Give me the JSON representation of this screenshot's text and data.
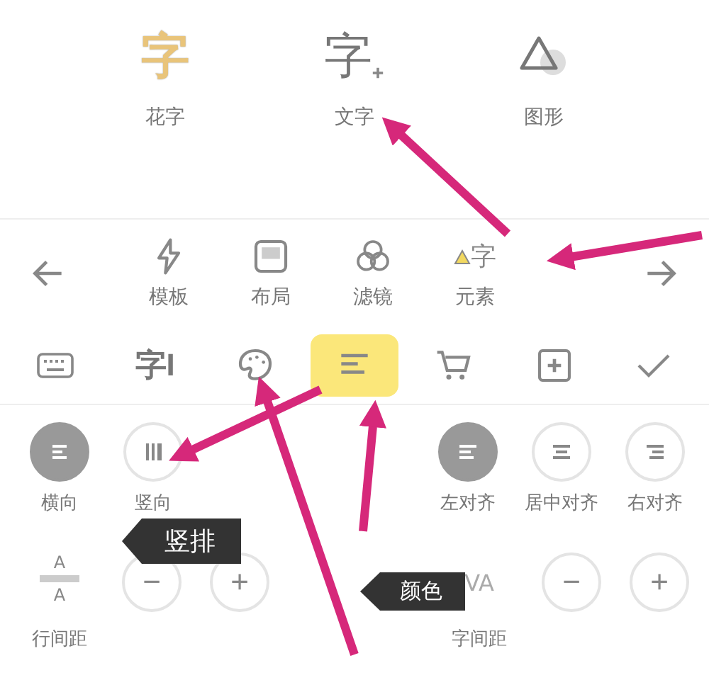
{
  "top_panel": {
    "items": [
      {
        "kind": "fancy",
        "glyph": "字",
        "label": "花字"
      },
      {
        "kind": "text",
        "glyph": "字",
        "label": "文字"
      },
      {
        "kind": "shape",
        "label": "图形"
      }
    ]
  },
  "nav": {
    "items": [
      {
        "kind": "template",
        "label": "模板"
      },
      {
        "kind": "layout",
        "label": "布局"
      },
      {
        "kind": "filter",
        "label": "滤镜"
      },
      {
        "kind": "element",
        "glyph": "字",
        "label": "元素"
      }
    ]
  },
  "toolbar": {
    "items": [
      {
        "kind": "keyboard",
        "selected": false
      },
      {
        "kind": "font",
        "glyph": "字I",
        "selected": false
      },
      {
        "kind": "palette",
        "selected": false
      },
      {
        "kind": "align",
        "selected": true
      },
      {
        "kind": "cart",
        "selected": false
      },
      {
        "kind": "add",
        "selected": false
      },
      {
        "kind": "check",
        "selected": false
      }
    ]
  },
  "orientation": [
    {
      "kind": "horizontal",
      "label": "横向",
      "selected": true
    },
    {
      "kind": "vertical",
      "label": "竖向",
      "selected": false
    }
  ],
  "alignment": [
    {
      "kind": "left",
      "label": "左对齐",
      "selected": true
    },
    {
      "kind": "center",
      "label": "居中对齐",
      "selected": false
    },
    {
      "kind": "right",
      "label": "右对齐",
      "selected": false
    }
  ],
  "spacing": [
    {
      "kind": "line",
      "glyph_top": "A",
      "glyph_bottom": "A",
      "label": "行间距",
      "minus": "−",
      "plus": "+"
    },
    {
      "kind": "letter",
      "glyph": "VA",
      "label": "字间距",
      "minus": "−",
      "plus": "+"
    }
  ],
  "callouts": [
    {
      "label": "竖排"
    },
    {
      "label": "颜色"
    }
  ]
}
